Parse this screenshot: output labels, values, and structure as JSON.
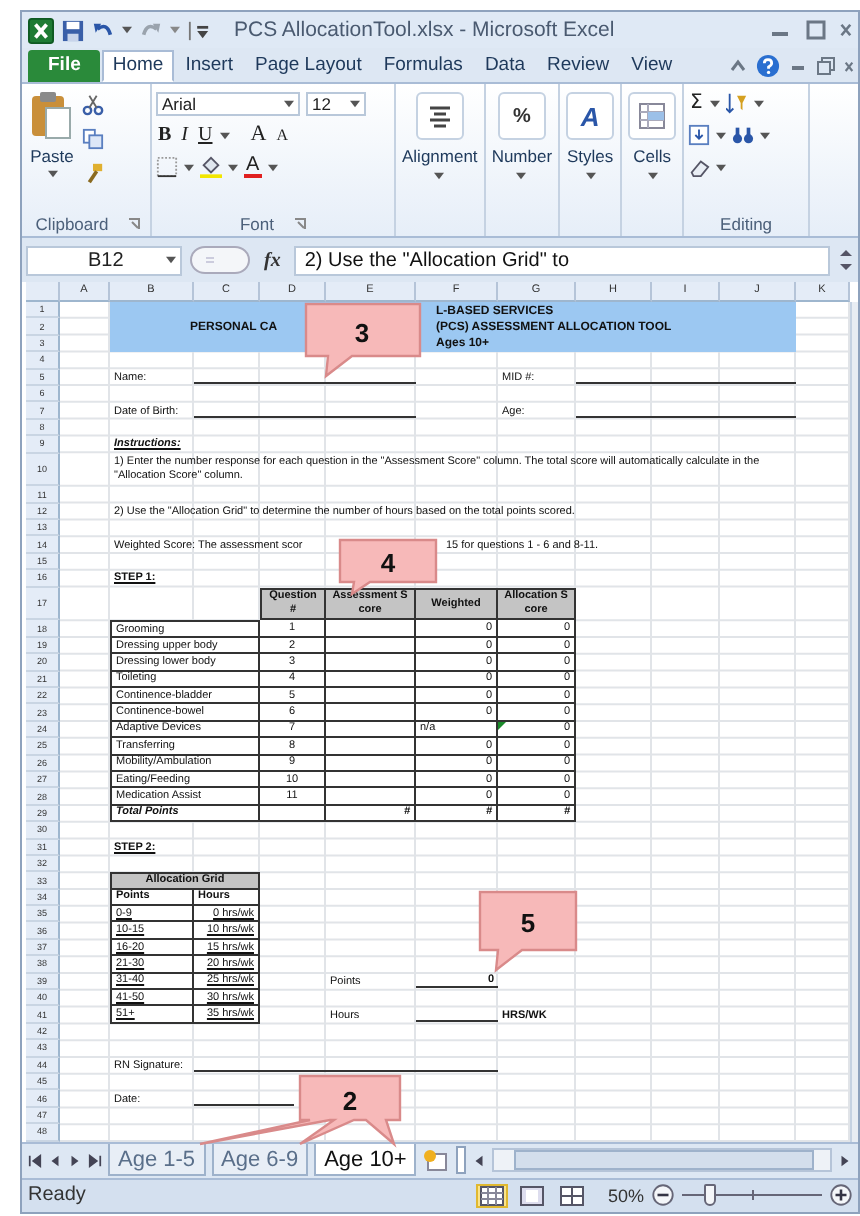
{
  "title_bar": {
    "title": "PCS AllocationTool.xlsx - Microsoft Excel"
  },
  "ribbon": {
    "tabs": [
      {
        "label": "File",
        "kind": "file",
        "selected": false
      },
      {
        "label": "Home",
        "kind": "tab",
        "selected": true
      },
      {
        "label": "Insert",
        "kind": "tab",
        "selected": false
      },
      {
        "label": "Page Layout",
        "kind": "tab",
        "selected": false
      },
      {
        "label": "Formulas",
        "kind": "tab",
        "selected": false
      },
      {
        "label": "Data",
        "kind": "tab",
        "selected": false
      },
      {
        "label": "Review",
        "kind": "tab",
        "selected": false
      },
      {
        "label": "View",
        "kind": "tab",
        "selected": false
      }
    ],
    "clipboard": {
      "paste": "Paste",
      "group_label": "Clipboard"
    },
    "font": {
      "name": "Arial",
      "size": "12",
      "bold": "B",
      "italic": "I",
      "underline": "U",
      "grow": "A",
      "shrink": "A",
      "font_color": "A",
      "group_label": "Font"
    },
    "groups": [
      {
        "label": "Alignment",
        "kind": "alignment"
      },
      {
        "label": "Number",
        "kind": "number",
        "symbol": "%"
      },
      {
        "label": "Styles",
        "kind": "styles",
        "symbol": "A"
      },
      {
        "label": "Cells",
        "kind": "cells"
      }
    ],
    "editing": {
      "autosum": "Σ",
      "group_label": "Editing"
    }
  },
  "formula_bar": {
    "name_box": "B12",
    "function_label": "fx",
    "formula": "2) Use the \"Allocation Grid\" to"
  },
  "sheet": {
    "column_headers": [
      "A",
      "B",
      "C",
      "D",
      "E",
      "F",
      "G",
      "H",
      "I",
      "J",
      "K"
    ],
    "row_numbers": [
      "1",
      "2",
      "3",
      "4",
      "5",
      "6",
      "7",
      "8",
      "9",
      "10",
      "11",
      "12",
      "13",
      "14",
      "15",
      "16",
      "17",
      "18",
      "19",
      "20",
      "21",
      "22",
      "23",
      "24",
      "25",
      "26",
      "27",
      "28",
      "29",
      "30",
      "31",
      "32",
      "33",
      "34",
      "35",
      "36",
      "37",
      "38",
      "39",
      "40",
      "41",
      "42",
      "43",
      "44",
      "45",
      "46",
      "47",
      "48"
    ],
    "title": {
      "line_1": "L-BASED SERVICES",
      "line_2_left": "PERSONAL CA",
      "line_2_right": "(PCS) ASSESSMENT ALLOCATION TOOL",
      "line_3": "Ages 10+"
    },
    "name_label": "Name:",
    "mid_label": "MID #:",
    "dob_label": "Date of Birth:",
    "age_label": "Age:",
    "instructions_heading": "Instructions:",
    "instruction_1": "1) Enter the number response for each question in the \"Assessment Score\" column. The total score will automatically calculate in the \"Allocation Score\" column.",
    "instruction_2": "2) Use the \"Allocation Grid\" to determine the number of hours based on the total points scored.",
    "weighted_note_left": "Weighted Score: The assessment scor",
    "weighted_note_right": "15 for questions 1 - 6 and 8-11.",
    "step_1": "STEP 1:",
    "score_table": {
      "columns": [
        "Question #",
        "Assessment Score",
        "Weighted",
        "Allocation Score"
      ],
      "rows": [
        {
          "item": "Grooming",
          "question": "1",
          "weighted": "0",
          "allocation": "0",
          "flagged": false
        },
        {
          "item": "Dressing upper body",
          "question": "2",
          "weighted": "0",
          "allocation": "0",
          "flagged": false
        },
        {
          "item": "Dressing lower body",
          "question": "3",
          "weighted": "0",
          "allocation": "0",
          "flagged": false
        },
        {
          "item": "Toileting",
          "question": "4",
          "weighted": "0",
          "allocation": "0",
          "flagged": false
        },
        {
          "item": "Continence-bladder",
          "question": "5",
          "weighted": "0",
          "allocation": "0",
          "flagged": false
        },
        {
          "item": "Continence-bowel",
          "question": "6",
          "weighted": "0",
          "allocation": "0",
          "flagged": false
        },
        {
          "item": "Adaptive Devices",
          "question": "7",
          "weighted": "n/a",
          "allocation": "0",
          "flagged": true
        },
        {
          "item": "Transferring",
          "question": "8",
          "weighted": "0",
          "allocation": "0",
          "flagged": false
        },
        {
          "item": "Mobility/Ambulation",
          "question": "9",
          "weighted": "0",
          "allocation": "0",
          "flagged": false
        },
        {
          "item": "Eating/Feeding",
          "question": "10",
          "weighted": "0",
          "allocation": "0",
          "flagged": false
        },
        {
          "item": "Medication Assist",
          "question": "11",
          "weighted": "0",
          "allocation": "0",
          "flagged": false
        }
      ],
      "total": {
        "label": "Total Points",
        "assessment": "#",
        "weighted": "#",
        "allocation": "#"
      }
    },
    "step_2": "STEP 2:",
    "allocation_grid": {
      "title": "Allocation Grid",
      "columns": [
        "Points",
        "Hours"
      ],
      "rows": [
        {
          "points": "0-9",
          "hours": "0 hrs/wk"
        },
        {
          "points": "10-15",
          "hours": "10 hrs/wk"
        },
        {
          "points": "16-20",
          "hours": "15 hrs/wk"
        },
        {
          "points": "21-30",
          "hours": "20 hrs/wk"
        },
        {
          "points": "31-40",
          "hours": "25 hrs/wk"
        },
        {
          "points": "41-50",
          "hours": "30 hrs/wk"
        },
        {
          "points": "51+",
          "hours": "35 hrs/wk"
        }
      ]
    },
    "points_label": "Points",
    "points_value": "0",
    "hours_label": "Hours",
    "hours_unit": "HRS/WK",
    "signature_label": "RN Signature:",
    "date_label": "Date:"
  },
  "sheet_tabs": [
    {
      "label": "Age 1-5",
      "selected": false
    },
    {
      "label": "Age 6-9",
      "selected": false
    },
    {
      "label": "Age 10+",
      "selected": true
    }
  ],
  "status_bar": {
    "status": "Ready",
    "views": [
      {
        "kind": "normal",
        "selected": true
      },
      {
        "kind": "page_layout",
        "selected": false
      },
      {
        "kind": "page_break",
        "selected": false
      }
    ],
    "zoom": "50%",
    "zoom_slider": {
      "level": 0.2
    }
  },
  "callouts": [
    {
      "label": "3"
    },
    {
      "label": "4"
    },
    {
      "label": "5"
    },
    {
      "label": "2"
    }
  ]
}
